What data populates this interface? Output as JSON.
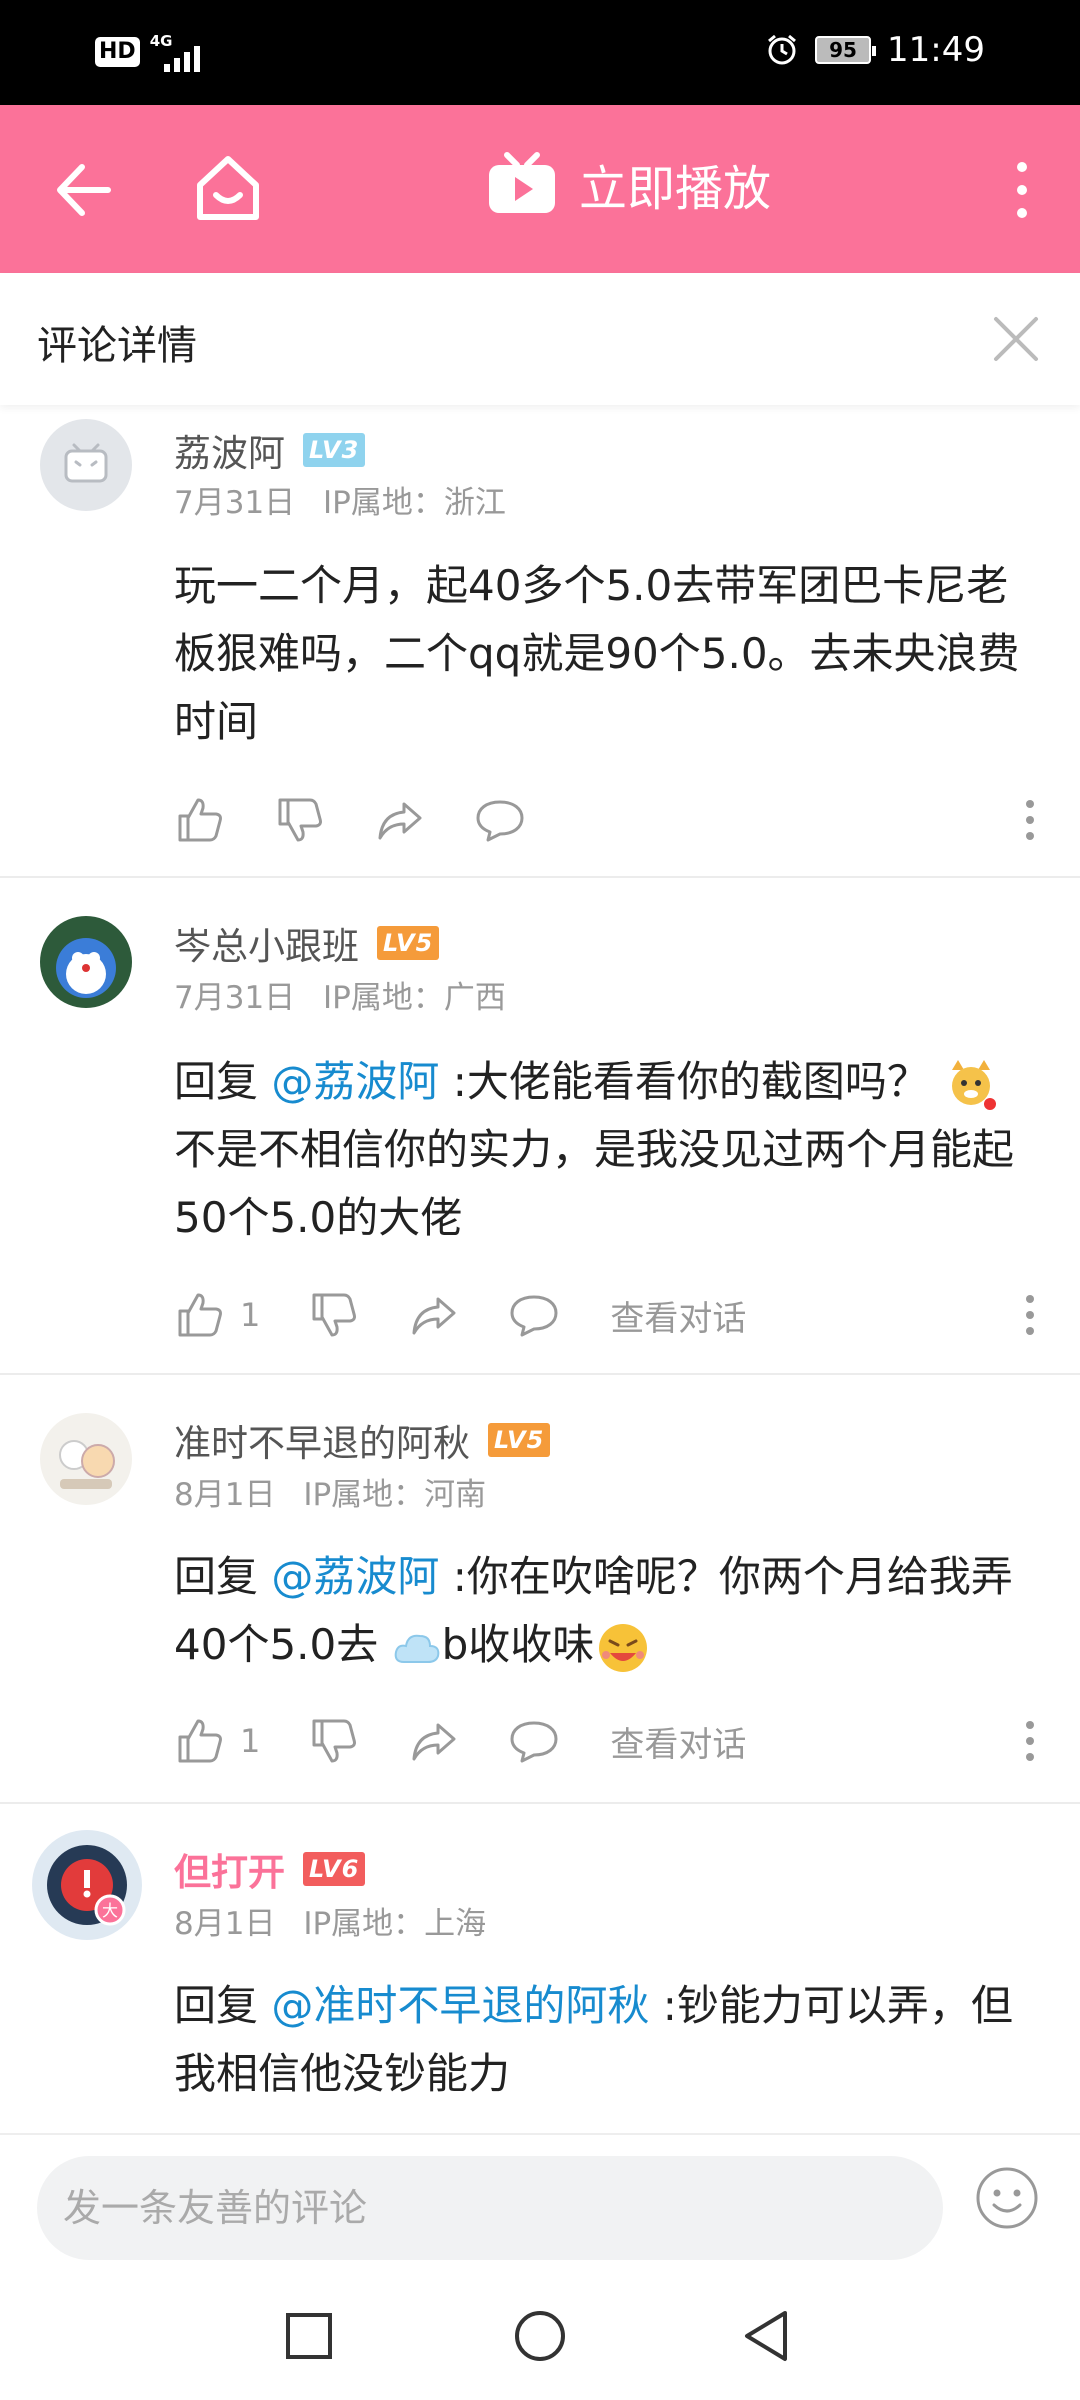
{
  "status": {
    "network": "4G",
    "hd": "HD",
    "battery": "95",
    "time": "11:49"
  },
  "topbar": {
    "play_label": "立即播放"
  },
  "detail": {
    "title": "评论详情"
  },
  "comments": [
    {
      "name": "荔波阿",
      "level": "LV3",
      "level_color": "#8fd3ee",
      "date": "7月31日",
      "ip": "IP属地：浙江",
      "body": "玩一二个月，起40多个5.0去带军团巴卡尼老板狠难吗，二个qq就是90个5.0。去未央浪费时间"
    },
    {
      "name": "岑总小跟班",
      "level": "LV5",
      "level_color": "#f59b3a",
      "date": "7月31日",
      "ip": "IP属地：广西",
      "reply_prefix": "回复 ",
      "mention": "@荔波阿",
      "body": " :大佬能看看你的截图吗？",
      "body2": "不是不相信你的实力，是我没见过两个月能起50个5.0的大佬",
      "likes": "1",
      "view_label": "查看对话"
    },
    {
      "name": "准时不早退的阿秋",
      "level": "LV5",
      "level_color": "#f59b3a",
      "date": "8月1日",
      "ip": "IP属地：河南",
      "reply_prefix": "回复 ",
      "mention": "@荔波阿",
      "body": " :你在吹啥呢？你两个月给我弄40个5.0去 ",
      "body2": "b收收味",
      "likes": "1",
      "view_label": "查看对话"
    },
    {
      "name": "但打开",
      "level": "LV6",
      "level_color": "#f25d5d",
      "date": "8月1日",
      "ip": "IP属地：上海",
      "reply_prefix": "回复 ",
      "mention": "@准时不早退的阿秋",
      "body": " :钞能力可以弄，但我相信他没钞能力"
    }
  ],
  "input": {
    "placeholder": "发一条友善的评论"
  },
  "icons": [
    "back-arrow-icon",
    "home-icon",
    "tv-icon",
    "more-vertical-icon",
    "close-icon",
    "thumb-up-icon",
    "thumb-down-icon",
    "share-icon",
    "comment-bubble-icon",
    "smile-icon",
    "nav-square-icon",
    "nav-circle-icon",
    "nav-triangle-icon"
  ],
  "colors": {
    "brand": "#fb7299",
    "mention": "#178bcf"
  }
}
